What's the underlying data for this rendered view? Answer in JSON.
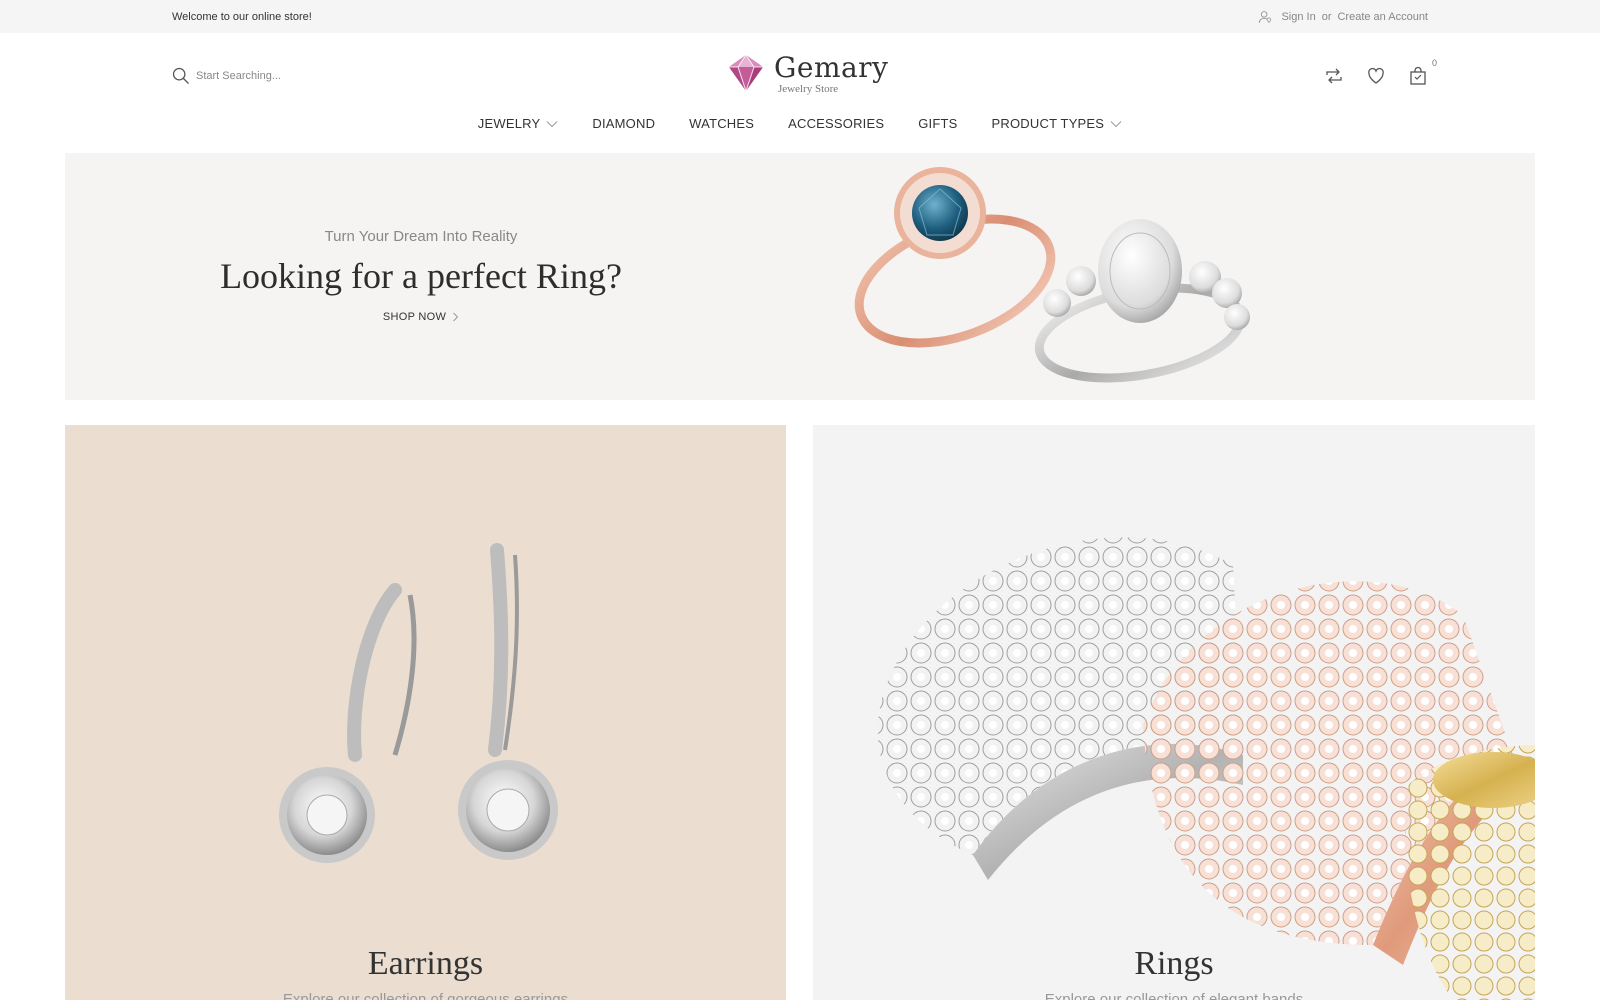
{
  "topbar": {
    "welcome": "Welcome to our online store!",
    "sign_in": "Sign In",
    "or": "or",
    "create_account": "Create an Account"
  },
  "header": {
    "search_placeholder": "Start Searching...",
    "brand": "Gemary",
    "brand_tagline": "Jewelry Store",
    "cart_count": "0",
    "icons": [
      "search-icon",
      "compare-icon",
      "heart-icon",
      "cart-icon",
      "user-icon"
    ]
  },
  "nav": {
    "items": [
      {
        "label": "JEWELRY",
        "dropdown": true
      },
      {
        "label": "DIAMOND",
        "dropdown": false
      },
      {
        "label": "WATCHES",
        "dropdown": false
      },
      {
        "label": "ACCESSORIES",
        "dropdown": false
      },
      {
        "label": "GIFTS",
        "dropdown": false
      },
      {
        "label": "PRODUCT TYPES",
        "dropdown": true
      }
    ]
  },
  "hero": {
    "subtitle": "Turn Your Dream Into Reality",
    "title": "Looking for a perfect Ring?",
    "cta": "SHOP NOW"
  },
  "categories": [
    {
      "title": "Earrings",
      "description": "Explore our collection of gorgeous earrings"
    },
    {
      "title": "Rings",
      "description": "Explore our collection of elegant bands"
    }
  ],
  "colors": {
    "accent_pink": "#c45c9a",
    "topbar_bg": "#f5f5f5",
    "hero_bg": "#f5f4f2",
    "earrings_bg": "#ebddd0",
    "rings_bg": "#f3f3f3",
    "rose_gold": "#e3a48a",
    "blue_stone": "#2d6f8f"
  }
}
